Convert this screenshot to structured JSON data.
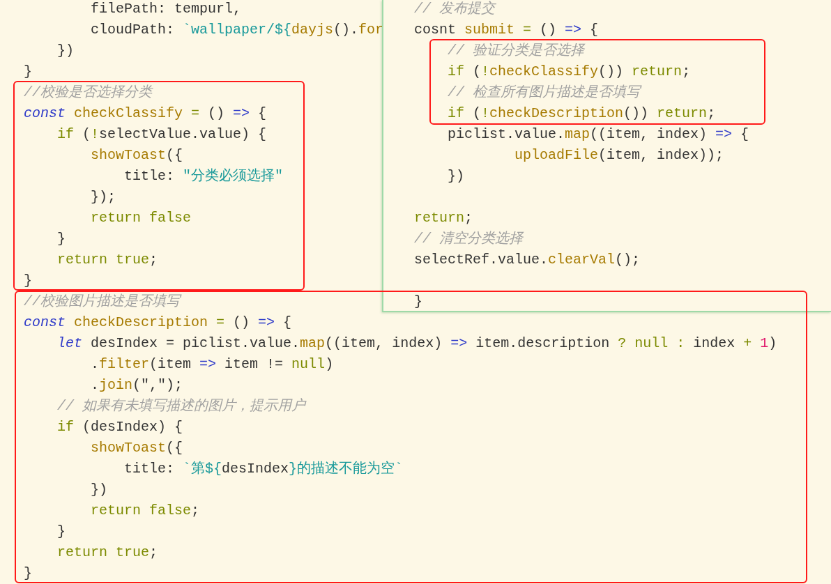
{
  "editor": {
    "lines": [
      {
        "tokens": [
          {
            "kind": "plain",
            "text": "        filePath: tempurl,"
          }
        ]
      },
      {
        "tokens": [
          {
            "kind": "plain",
            "text": "        cloudPath: "
          },
          {
            "kind": "string",
            "text": "`wallpaper/${"
          },
          {
            "kind": "func",
            "text": "dayjs"
          },
          {
            "kind": "plain",
            "text": "()."
          },
          {
            "kind": "func",
            "text": "for"
          }
        ]
      },
      {
        "tokens": [
          {
            "kind": "plain",
            "text": "    })"
          }
        ]
      },
      {
        "tokens": [
          {
            "kind": "plain",
            "text": "}"
          }
        ]
      },
      {
        "tokens": [
          {
            "kind": "comment",
            "text": "//校验是否选择分类"
          }
        ]
      },
      {
        "tokens": [
          {
            "kind": "keyword",
            "text": "const"
          },
          {
            "kind": "func",
            "text": " checkClassify "
          },
          {
            "kind": "control",
            "text": "="
          },
          {
            "kind": "plain",
            "text": " () "
          },
          {
            "kind": "arrow",
            "text": "=>"
          },
          {
            "kind": "plain",
            "text": " {"
          }
        ]
      },
      {
        "tokens": [
          {
            "kind": "control",
            "text": "    if"
          },
          {
            "kind": "plain",
            "text": " ("
          },
          {
            "kind": "control",
            "text": "!"
          },
          {
            "kind": "plain",
            "text": "selectValue.value) {"
          }
        ]
      },
      {
        "tokens": [
          {
            "kind": "func",
            "text": "        showToast"
          },
          {
            "kind": "plain",
            "text": "({"
          }
        ]
      },
      {
        "tokens": [
          {
            "kind": "plain",
            "text": "            title: "
          },
          {
            "kind": "string",
            "text": "\"分类必须选择\""
          }
        ]
      },
      {
        "tokens": [
          {
            "kind": "plain",
            "text": "        });"
          }
        ]
      },
      {
        "tokens": [
          {
            "kind": "control",
            "text": "        return false"
          }
        ]
      },
      {
        "tokens": [
          {
            "kind": "plain",
            "text": "    }"
          }
        ]
      },
      {
        "tokens": [
          {
            "kind": "control",
            "text": "    return true"
          },
          {
            "kind": "plain",
            "text": ";"
          }
        ]
      },
      {
        "tokens": [
          {
            "kind": "plain",
            "text": "}"
          }
        ]
      },
      {
        "tokens": [
          {
            "kind": "comment",
            "text": "//校验图片描述是否填写"
          }
        ]
      },
      {
        "tokens": [
          {
            "kind": "keyword",
            "text": "const"
          },
          {
            "kind": "func",
            "text": " checkDescription "
          },
          {
            "kind": "control",
            "text": "="
          },
          {
            "kind": "plain",
            "text": " () "
          },
          {
            "kind": "arrow",
            "text": "=>"
          },
          {
            "kind": "plain",
            "text": " {"
          }
        ]
      },
      {
        "tokens": [
          {
            "kind": "keyword",
            "text": "    let"
          },
          {
            "kind": "plain",
            "text": " desIndex = piclist.value."
          },
          {
            "kind": "func",
            "text": "map"
          },
          {
            "kind": "plain",
            "text": "((item, index) "
          },
          {
            "kind": "arrow",
            "text": "=>"
          },
          {
            "kind": "plain",
            "text": " item.description "
          },
          {
            "kind": "control",
            "text": "? null :"
          },
          {
            "kind": "plain",
            "text": " index "
          },
          {
            "kind": "control",
            "text": "+"
          },
          {
            "kind": "number",
            "text": " 1"
          },
          {
            "kind": "plain",
            "text": ")"
          }
        ]
      },
      {
        "tokens": [
          {
            "kind": "plain",
            "text": "        ."
          },
          {
            "kind": "func",
            "text": "filter"
          },
          {
            "kind": "plain",
            "text": "(item "
          },
          {
            "kind": "arrow",
            "text": "=>"
          },
          {
            "kind": "plain",
            "text": " item != "
          },
          {
            "kind": "control",
            "text": "null"
          },
          {
            "kind": "plain",
            "text": ")"
          }
        ]
      },
      {
        "tokens": [
          {
            "kind": "plain",
            "text": "        ."
          },
          {
            "kind": "func",
            "text": "join"
          },
          {
            "kind": "plain",
            "text": "(\",\");"
          }
        ]
      },
      {
        "tokens": [
          {
            "kind": "comment",
            "text": "    // 如果有未填写描述的图片，提示用户"
          }
        ]
      },
      {
        "tokens": [
          {
            "kind": "control",
            "text": "    if"
          },
          {
            "kind": "plain",
            "text": " (desIndex) {"
          }
        ]
      },
      {
        "tokens": [
          {
            "kind": "func",
            "text": "        showToast"
          },
          {
            "kind": "plain",
            "text": "({"
          }
        ]
      },
      {
        "tokens": [
          {
            "kind": "plain",
            "text": "            title: "
          },
          {
            "kind": "string",
            "text": "`第${"
          },
          {
            "kind": "plain",
            "text": "desIndex"
          },
          {
            "kind": "string",
            "text": "}的描述不能为空`"
          }
        ]
      },
      {
        "tokens": [
          {
            "kind": "plain",
            "text": "        })"
          }
        ]
      },
      {
        "tokens": [
          {
            "kind": "control",
            "text": "        return false"
          },
          {
            "kind": "plain",
            "text": ";"
          }
        ]
      },
      {
        "tokens": [
          {
            "kind": "plain",
            "text": "    }"
          }
        ]
      },
      {
        "tokens": [
          {
            "kind": "control",
            "text": "    return true"
          },
          {
            "kind": "plain",
            "text": ";"
          }
        ]
      },
      {
        "tokens": [
          {
            "kind": "plain",
            "text": "}"
          }
        ]
      }
    ]
  },
  "overlay_editor": {
    "lines": [
      {
        "tokens": [
          {
            "kind": "comment",
            "text": "// 发布提交"
          }
        ]
      },
      {
        "tokens": [
          {
            "kind": "plain",
            "text": "cosnt "
          },
          {
            "kind": "func",
            "text": "submit "
          },
          {
            "kind": "control",
            "text": "="
          },
          {
            "kind": "plain",
            "text": " () "
          },
          {
            "kind": "arrow",
            "text": "=>"
          },
          {
            "kind": "plain",
            "text": " {"
          }
        ]
      },
      {
        "tokens": [
          {
            "kind": "comment",
            "text": "    // 验证分类是否选择"
          }
        ]
      },
      {
        "tokens": [
          {
            "kind": "control",
            "text": "    if"
          },
          {
            "kind": "plain",
            "text": " ("
          },
          {
            "kind": "control",
            "text": "!"
          },
          {
            "kind": "func",
            "text": "checkClassify"
          },
          {
            "kind": "plain",
            "text": "()) "
          },
          {
            "kind": "control",
            "text": "return"
          },
          {
            "kind": "plain",
            "text": ";"
          }
        ]
      },
      {
        "tokens": [
          {
            "kind": "comment",
            "text": "    // 检查所有图片描述是否填写"
          }
        ]
      },
      {
        "tokens": [
          {
            "kind": "control",
            "text": "    if"
          },
          {
            "kind": "plain",
            "text": " ("
          },
          {
            "kind": "control",
            "text": "!"
          },
          {
            "kind": "func",
            "text": "checkDescription"
          },
          {
            "kind": "plain",
            "text": "()) "
          },
          {
            "kind": "control",
            "text": "return"
          },
          {
            "kind": "plain",
            "text": ";"
          }
        ]
      },
      {
        "tokens": [
          {
            "kind": "plain",
            "text": "    piclist.value."
          },
          {
            "kind": "func",
            "text": "map"
          },
          {
            "kind": "plain",
            "text": "((item, index) "
          },
          {
            "kind": "arrow",
            "text": "=>"
          },
          {
            "kind": "plain",
            "text": " {"
          }
        ]
      },
      {
        "tokens": [
          {
            "kind": "func",
            "text": "            uploadFile"
          },
          {
            "kind": "plain",
            "text": "(item, index));"
          }
        ]
      },
      {
        "tokens": [
          {
            "kind": "plain",
            "text": "    })"
          }
        ]
      },
      {
        "kind": "blank"
      },
      {
        "tokens": [
          {
            "kind": "control",
            "text": "return"
          },
          {
            "kind": "plain",
            "text": ";"
          }
        ]
      },
      {
        "tokens": [
          {
            "kind": "comment",
            "text": "// 清空分类选择"
          }
        ]
      },
      {
        "tokens": [
          {
            "kind": "plain",
            "text": "selectRef.value."
          },
          {
            "kind": "func",
            "text": "clearVal"
          },
          {
            "kind": "plain",
            "text": "();"
          }
        ]
      },
      {
        "kind": "blank"
      },
      {
        "tokens": [
          {
            "kind": "plain",
            "text": "}"
          }
        ]
      }
    ]
  }
}
